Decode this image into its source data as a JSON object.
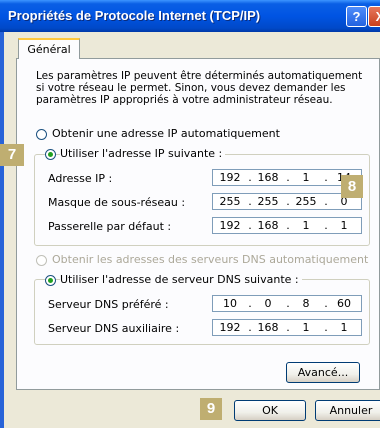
{
  "window": {
    "title": "Propriétés de Protocole Internet (TCP/IP)",
    "help_label": "?",
    "close_label": "X"
  },
  "tabs": [
    {
      "label": "Général"
    }
  ],
  "intro_text": "Les paramètres IP peuvent être déterminés automatiquement si votre réseau le permet. Sinon, vous devez demander les paramètres IP appropriés à votre administrateur réseau.",
  "ip_mode": {
    "auto_label": "Obtenir une adresse IP automatiquement",
    "manual_label": "Utiliser l'adresse IP suivante :",
    "selected": "manual"
  },
  "ip_fields": {
    "address": {
      "label": "Adresse IP :",
      "octets": [
        "192",
        "168",
        "1",
        "14"
      ]
    },
    "subnet": {
      "label": "Masque de sous-réseau :",
      "octets": [
        "255",
        "255",
        "255",
        "0"
      ]
    },
    "gateway": {
      "label": "Passerelle par défaut :",
      "octets": [
        "192",
        "168",
        "1",
        "1"
      ]
    }
  },
  "dns_mode": {
    "auto_label": "Obtenir les adresses des serveurs DNS automatiquement",
    "manual_label": "Utiliser l'adresse de serveur DNS suivante :",
    "selected": "manual"
  },
  "dns_fields": {
    "preferred": {
      "label": "Serveur DNS préféré :",
      "octets": [
        "10",
        "0",
        "8",
        "60"
      ]
    },
    "alternate": {
      "label": "Serveur DNS auxiliaire :",
      "octets": [
        "192",
        "168",
        "1",
        "1"
      ]
    }
  },
  "buttons": {
    "advanced": "Avancé...",
    "ok": "OK",
    "cancel": "Annuler"
  },
  "callouts": {
    "step7": "7",
    "step8": "8",
    "step9": "9"
  },
  "colors": {
    "title_bar": "#0054e3",
    "dialog_bg": "#ece9d8",
    "callout": "#bfae71",
    "radio_dot": "#21a121"
  }
}
